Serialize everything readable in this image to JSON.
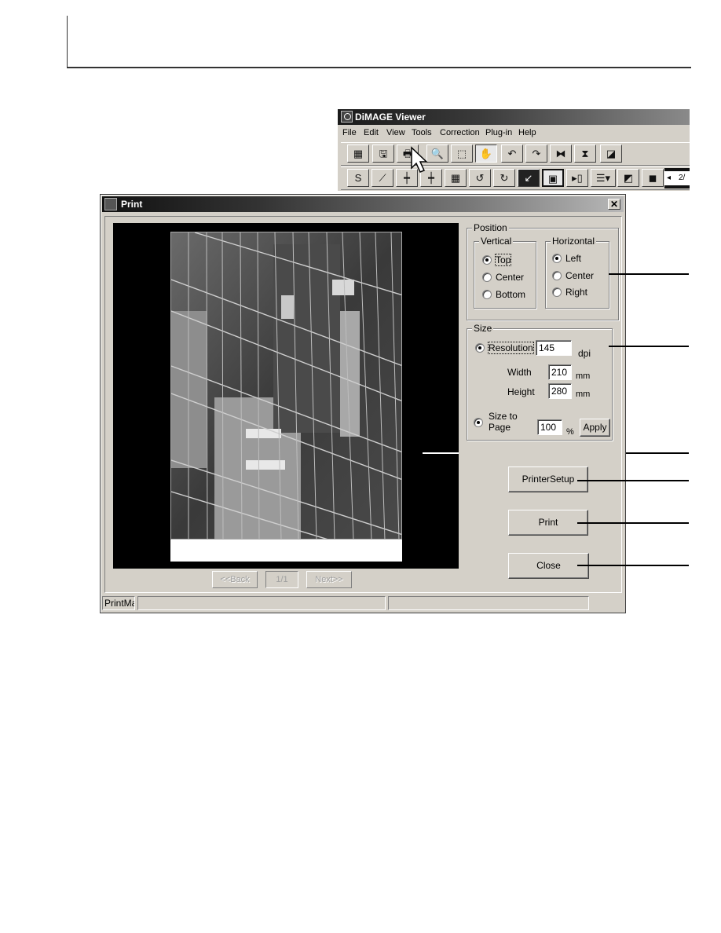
{
  "viewer": {
    "title": "DiMAGE Viewer",
    "menu": [
      "File",
      "Edit",
      "View",
      "Tools",
      "Correction",
      "Plug-in",
      "Help"
    ],
    "toolbar_row1": [
      {
        "name": "thumbnail-return-icon",
        "glyph": "▦"
      },
      {
        "name": "save-icon",
        "glyph": "🖫"
      },
      {
        "name": "print-icon",
        "glyph": "🖶"
      },
      {
        "name": "zoom-icon",
        "glyph": "🔍"
      },
      {
        "name": "select-rect-icon",
        "glyph": "⬚"
      },
      {
        "name": "hand-icon",
        "glyph": "✋"
      },
      {
        "name": "rotate-left-icon",
        "glyph": "↶"
      },
      {
        "name": "rotate-right-icon",
        "glyph": "↷"
      },
      {
        "name": "flip-horizontal-icon",
        "glyph": "⧓"
      },
      {
        "name": "flip-vertical-icon",
        "glyph": "⧗"
      },
      {
        "name": "resize-icon",
        "glyph": "◪"
      }
    ],
    "toolbar_row2": [
      {
        "name": "color-balance-icon",
        "glyph": "S"
      },
      {
        "name": "tone-curve-icon",
        "glyph": "⟋"
      },
      {
        "name": "brightness-slider-icon",
        "glyph": "┿"
      },
      {
        "name": "saturation-slider-icon",
        "glyph": "┿"
      },
      {
        "name": "variations-icon",
        "glyph": "▦"
      },
      {
        "name": "undo-icon",
        "glyph": "↺"
      },
      {
        "name": "redo-icon",
        "glyph": "↻"
      },
      {
        "name": "revert-icon",
        "glyph": "↙"
      },
      {
        "name": "snapshot-icon",
        "glyph": "▣"
      },
      {
        "name": "image-info-icon",
        "glyph": "▸▯"
      },
      {
        "name": "list-menu-icon",
        "glyph": "☰▾"
      },
      {
        "name": "compare-icon",
        "glyph": "◩"
      },
      {
        "name": "overlay-icon",
        "glyph": "◼"
      }
    ],
    "filmstrip_label": "2/"
  },
  "dialog": {
    "title": "Print",
    "close_glyph": "✕",
    "position": {
      "label": "Position",
      "vertical": {
        "label": "Vertical",
        "options": [
          "Top",
          "Center",
          "Bottom"
        ],
        "selected": "Top"
      },
      "horizontal": {
        "label": "Horizontal",
        "options": [
          "Left",
          "Center",
          "Right"
        ],
        "selected": "Left"
      }
    },
    "size": {
      "label": "Size",
      "resolution_label": "Resolution",
      "resolution_value": "145",
      "resolution_unit": "dpi",
      "width_label": "Width",
      "width_value": "210",
      "width_unit": "mm",
      "height_label": "Height",
      "height_value": "280",
      "height_unit": "mm",
      "size_to_page_label_1": "Size to",
      "size_to_page_label_2": "Page",
      "size_to_page_value": "100",
      "size_to_page_unit": "%",
      "apply_label": "Apply"
    },
    "buttons": {
      "printer_setup": "PrinterSetup",
      "print": "Print",
      "close": "Close"
    },
    "nav": {
      "back": "<<Back",
      "page": "1/1",
      "next": "Next>>"
    },
    "status": {
      "app": "PrintMaster",
      "pane2": "",
      "pane3": ""
    }
  }
}
